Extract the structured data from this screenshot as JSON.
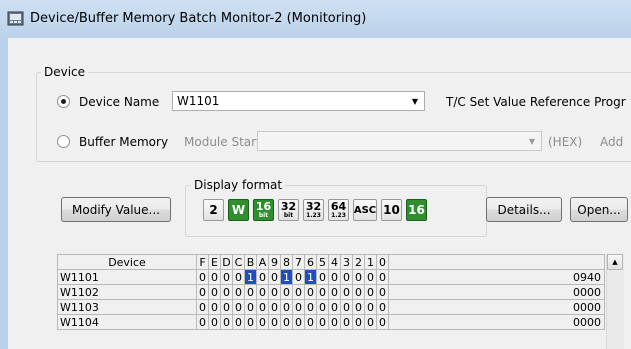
{
  "window": {
    "title": "Device/Buffer Memory Batch Monitor-2 (Monitoring)"
  },
  "device_group": {
    "legend": "Device",
    "device_name_label": "Device Name",
    "device_name_value": "W1101",
    "tc_label": "T/C Set Value Reference Progr",
    "buffer_memory_label": "Buffer Memory",
    "module_start_label": "Module Start",
    "hex_label": "(HEX)",
    "address_label": "Add"
  },
  "toolbar": {
    "modify_value_label": "Modify Value...",
    "display_format_legend": "Display format",
    "formats": [
      {
        "name": "2",
        "style": "plain"
      },
      {
        "name": "W",
        "style": "green"
      },
      {
        "name": "16bit",
        "top": "16",
        "bottom": "bit",
        "style": "green-stack"
      },
      {
        "name": "32bit",
        "top": "32",
        "bottom": "bit",
        "style": "stack"
      },
      {
        "name": "32real",
        "top": "32",
        "bottom": "1.23",
        "style": "stack"
      },
      {
        "name": "64real",
        "top": "64",
        "bottom": "1.23",
        "style": "stack"
      },
      {
        "name": "ASC",
        "style": "plain"
      },
      {
        "name": "10",
        "style": "plain"
      },
      {
        "name": "16",
        "style": "green"
      }
    ],
    "details_label": "Details...",
    "open_label": "Open..."
  },
  "table": {
    "columns": [
      "Device",
      "F",
      "E",
      "D",
      "C",
      "B",
      "A",
      "9",
      "8",
      "7",
      "6",
      "5",
      "4",
      "3",
      "2",
      "1",
      "0",
      ""
    ],
    "rows": [
      {
        "device": "W1101",
        "bits": [
          "0",
          "0",
          "0",
          "0",
          "1",
          "0",
          "0",
          "1",
          "0",
          "1",
          "0",
          "0",
          "0",
          "0",
          "0",
          "0"
        ],
        "value": "0940"
      },
      {
        "device": "W1102",
        "bits": [
          "0",
          "0",
          "0",
          "0",
          "0",
          "0",
          "0",
          "0",
          "0",
          "0",
          "0",
          "0",
          "0",
          "0",
          "0",
          "0"
        ],
        "value": "0000"
      },
      {
        "device": "W1103",
        "bits": [
          "0",
          "0",
          "0",
          "0",
          "0",
          "0",
          "0",
          "0",
          "0",
          "0",
          "0",
          "0",
          "0",
          "0",
          "0",
          "0"
        ],
        "value": "0000"
      },
      {
        "device": "W1104",
        "bits": [
          "0",
          "0",
          "0",
          "0",
          "0",
          "0",
          "0",
          "0",
          "0",
          "0",
          "0",
          "0",
          "0",
          "0",
          "0",
          "0"
        ],
        "value": "0000"
      }
    ]
  },
  "colors": {
    "bit_on": "#1d4fc4",
    "accent_green": "#2f8f2f"
  }
}
